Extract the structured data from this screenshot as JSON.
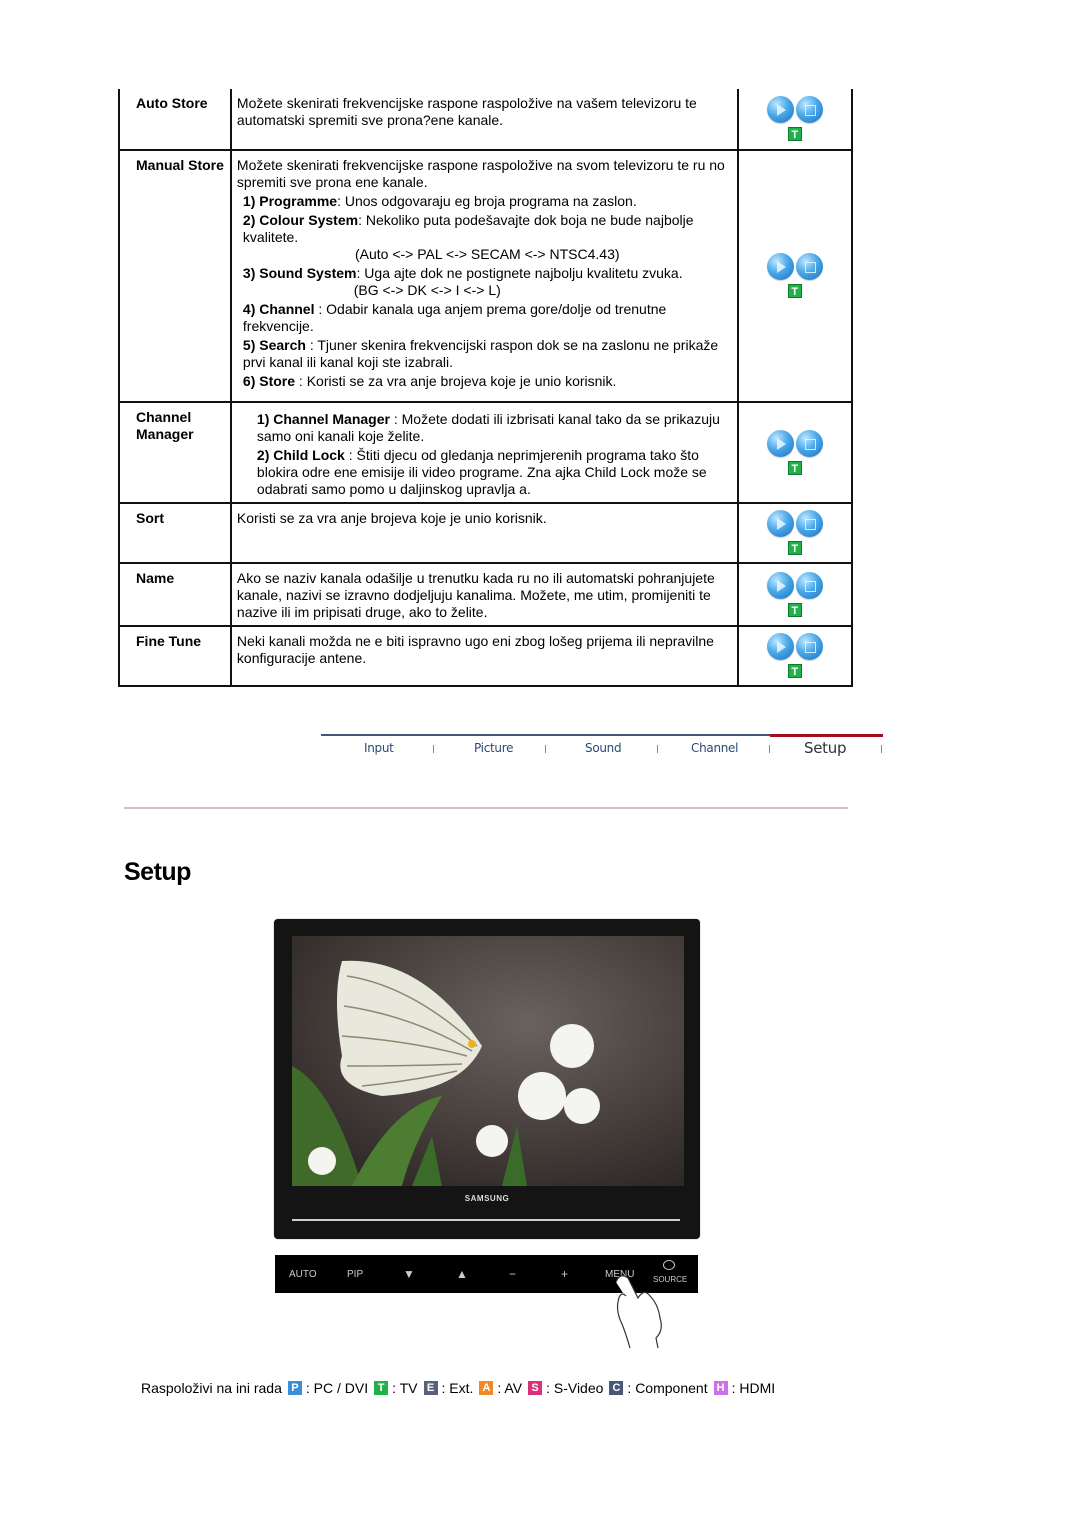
{
  "table": {
    "rows": [
      {
        "label": "Auto Store",
        "text": "Možete skenirati frekvencijske raspone raspoložive na vašem televizoru te automatski spremiti sve prona?ene kanale."
      },
      {
        "label": "Manual Store",
        "text": "Možete skenirati frekvencijske raspone raspoložive na svom televizoru te ru  no spremiti sve prona  ene kanale.",
        "items": [
          {
            "num": "1) Programme",
            "text": ": Unos odgovaraju  eg broja programa na zaslon."
          },
          {
            "num": "2) Colour System",
            "text": ": Nekoliko puta podešavajte dok boja ne bude najbolje kvalitete.",
            "note": "(Auto <-> PAL <-> SECAM <-> NTSC4.43)"
          },
          {
            "num": "3) Sound System",
            "text": ": Uga  ajte dok ne postignete najbolju kvalitetu zvuka.",
            "note": "(BG <-> DK <-> I <-> L)"
          },
          {
            "num": "4) Channel",
            "text": " : Odabir kanala uga  anjem prema gore/dolje od trenutne frekvencije."
          },
          {
            "num": "5) Search",
            "text": " : Tjuner skenira frekvencijski raspon dok se na zaslonu ne prikaže prvi kanal ili kanal koji ste izabrali."
          },
          {
            "num": "6) Store",
            "text": " : Koristi se za vra  anje brojeva koje je unio korisnik."
          }
        ]
      },
      {
        "label": "Channel Manager",
        "items": [
          {
            "num": "1) Channel Manager",
            "text": " : Možete dodati ili izbrisati kanal tako da se prikazuju samo oni kanali koje želite."
          },
          {
            "num": "2) Child Lock",
            "text": " : Štiti djecu od gledanja neprimjerenih programa tako što blokira odre  ene emisije ili video programe. Zna  ajka Child Lock može se odabrati samo pomo  u daljinskog upravlja  a."
          }
        ]
      },
      {
        "label": "Sort",
        "text": "Koristi se za vra  anje brojeva koje je unio korisnik."
      },
      {
        "label": "Name",
        "text": "Ako se naziv kanala odašilje u trenutku kada ru  no ili automatski pohranjujete kanale, nazivi se izravno dodjeljuju kanalima. Možete, me  utim, promijeniti te nazive ili im pripisati druge, ako to želite."
      },
      {
        "label": "Fine Tune",
        "text": "Neki kanali možda ne  e biti ispravno ugo  eni zbog lošeg prijema ili nepravilne konfiguracije antene."
      }
    ],
    "mode_badge": "T"
  },
  "nav": {
    "tabs": [
      "Input",
      "Picture",
      "Sound",
      "Channel",
      "Setup"
    ],
    "active": "Setup",
    "colors": {
      "line": "#405878",
      "active_line": "#a01018",
      "tab_text": "#2a4a78"
    }
  },
  "section_title": "Setup",
  "monitor": {
    "brand": "SAMSUNG",
    "buttons": [
      "AUTO",
      "PIP",
      "▼",
      "▲",
      "−",
      "+",
      "MENU",
      "SOURCE"
    ]
  },
  "legend": {
    "prefix": "Raspoloživi na  ini rada",
    "modes": [
      {
        "badge": "P",
        "label": ": PC / DVI",
        "color": "#3a8fd8"
      },
      {
        "badge": "T",
        "label": ": TV",
        "color": "#22b04a"
      },
      {
        "badge": "E",
        "label": ": Ext.",
        "color": "#58607a"
      },
      {
        "badge": "A",
        "label": ": AV",
        "color": "#f08a28"
      },
      {
        "badge": "S",
        "label": ": S-Video",
        "color": "#d8307a"
      },
      {
        "badge": "C",
        "label": ": Component",
        "color": "#4a5878"
      },
      {
        "badge": "H",
        "label": ": HDMI",
        "color": "#d070e8"
      }
    ]
  }
}
